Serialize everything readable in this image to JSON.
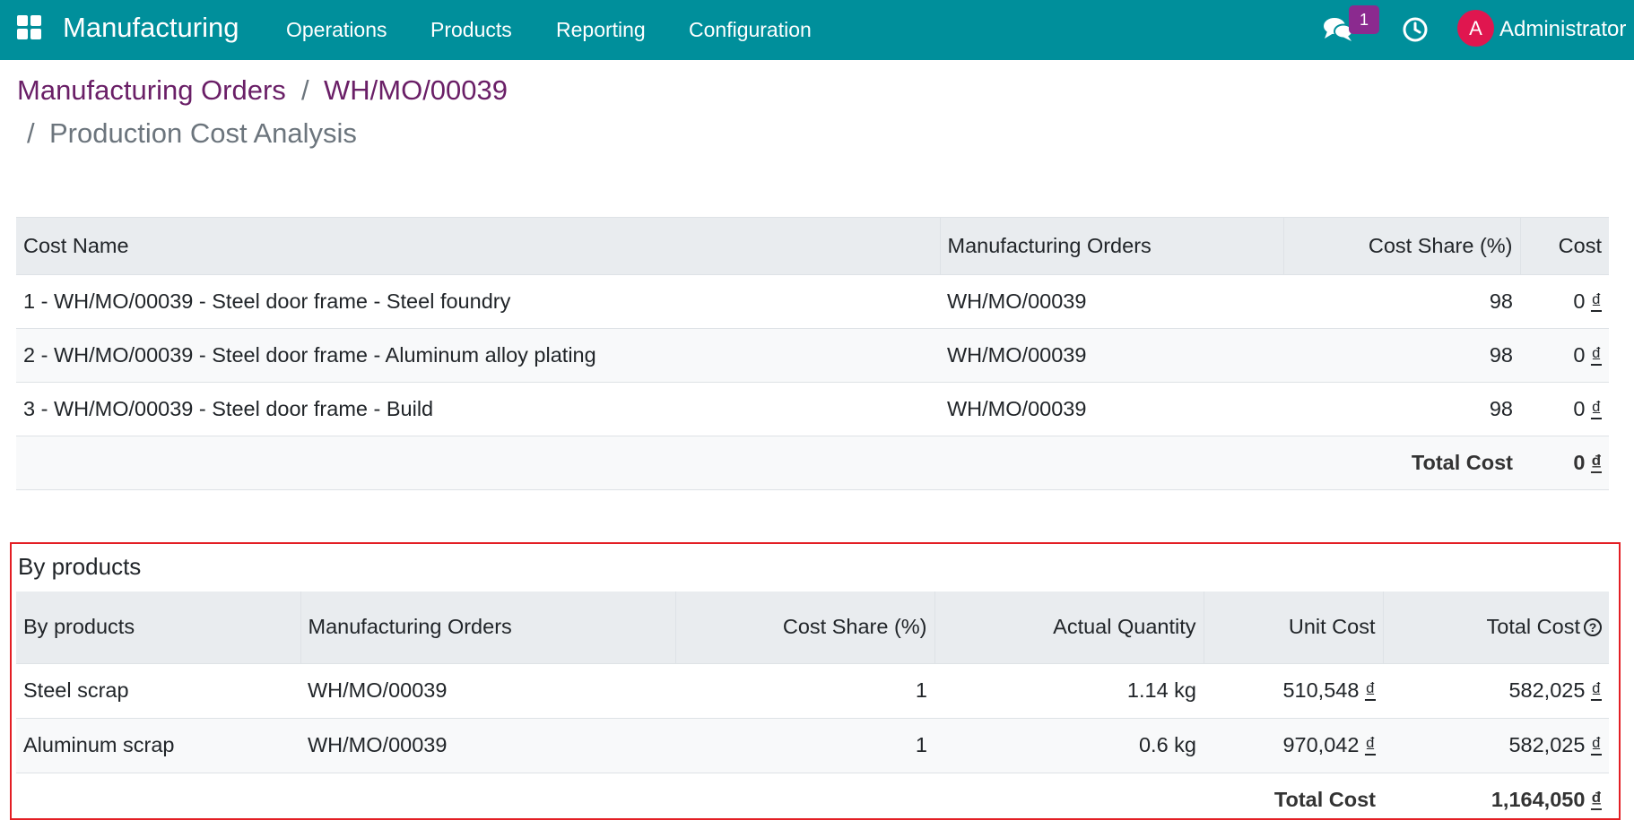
{
  "navbar": {
    "app_name": "Manufacturing",
    "menu": [
      "Operations",
      "Products",
      "Reporting",
      "Configuration"
    ],
    "message_count": "1",
    "user_initial": "A",
    "user_name": "Administrator"
  },
  "breadcrumb": {
    "items": [
      "Manufacturing Orders",
      "WH/MO/00039"
    ],
    "separator": "/",
    "current": "Production Cost Analysis"
  },
  "cost_table": {
    "headers": [
      "Cost Name",
      "Manufacturing Orders",
      "Cost Share (%)",
      "Cost"
    ],
    "rows": [
      {
        "name": "1 - WH/MO/00039 - Steel door frame - Steel foundry",
        "mo": "WH/MO/00039",
        "share": "98",
        "cost": "0",
        "currency": "₫"
      },
      {
        "name": "2 - WH/MO/00039 - Steel door frame - Aluminum alloy plating",
        "mo": "WH/MO/00039",
        "share": "98",
        "cost": "0",
        "currency": "₫"
      },
      {
        "name": "3 - WH/MO/00039 - Steel door frame - Build",
        "mo": "WH/MO/00039",
        "share": "98",
        "cost": "0",
        "currency": "₫"
      }
    ],
    "total_label": "Total Cost",
    "total_value": "0",
    "total_currency": "₫"
  },
  "byproducts": {
    "section_title": "By products",
    "headers": [
      "By products",
      "Manufacturing Orders",
      "Cost Share (%)",
      "Actual Quantity",
      "Unit Cost",
      "Total Cost"
    ],
    "help_glyph": "?",
    "rows": [
      {
        "product": "Steel scrap",
        "mo": "WH/MO/00039",
        "share": "1",
        "qty": "1.14 kg",
        "unit_cost": "510,548",
        "total_cost": "582,025",
        "currency": "₫"
      },
      {
        "product": "Aluminum scrap",
        "mo": "WH/MO/00039",
        "share": "1",
        "qty": "0.6 kg",
        "unit_cost": "970,042",
        "total_cost": "582,025",
        "currency": "₫"
      }
    ],
    "total_label": "Total Cost",
    "total_value": "1,164,050",
    "total_currency": "₫"
  },
  "colors": {
    "navbar": "#008f9b",
    "breadcrumb_link": "#6a1f67",
    "badge": "#8b2a8f",
    "avatar": "#e0164f",
    "highlight_box": "#e31e24"
  }
}
